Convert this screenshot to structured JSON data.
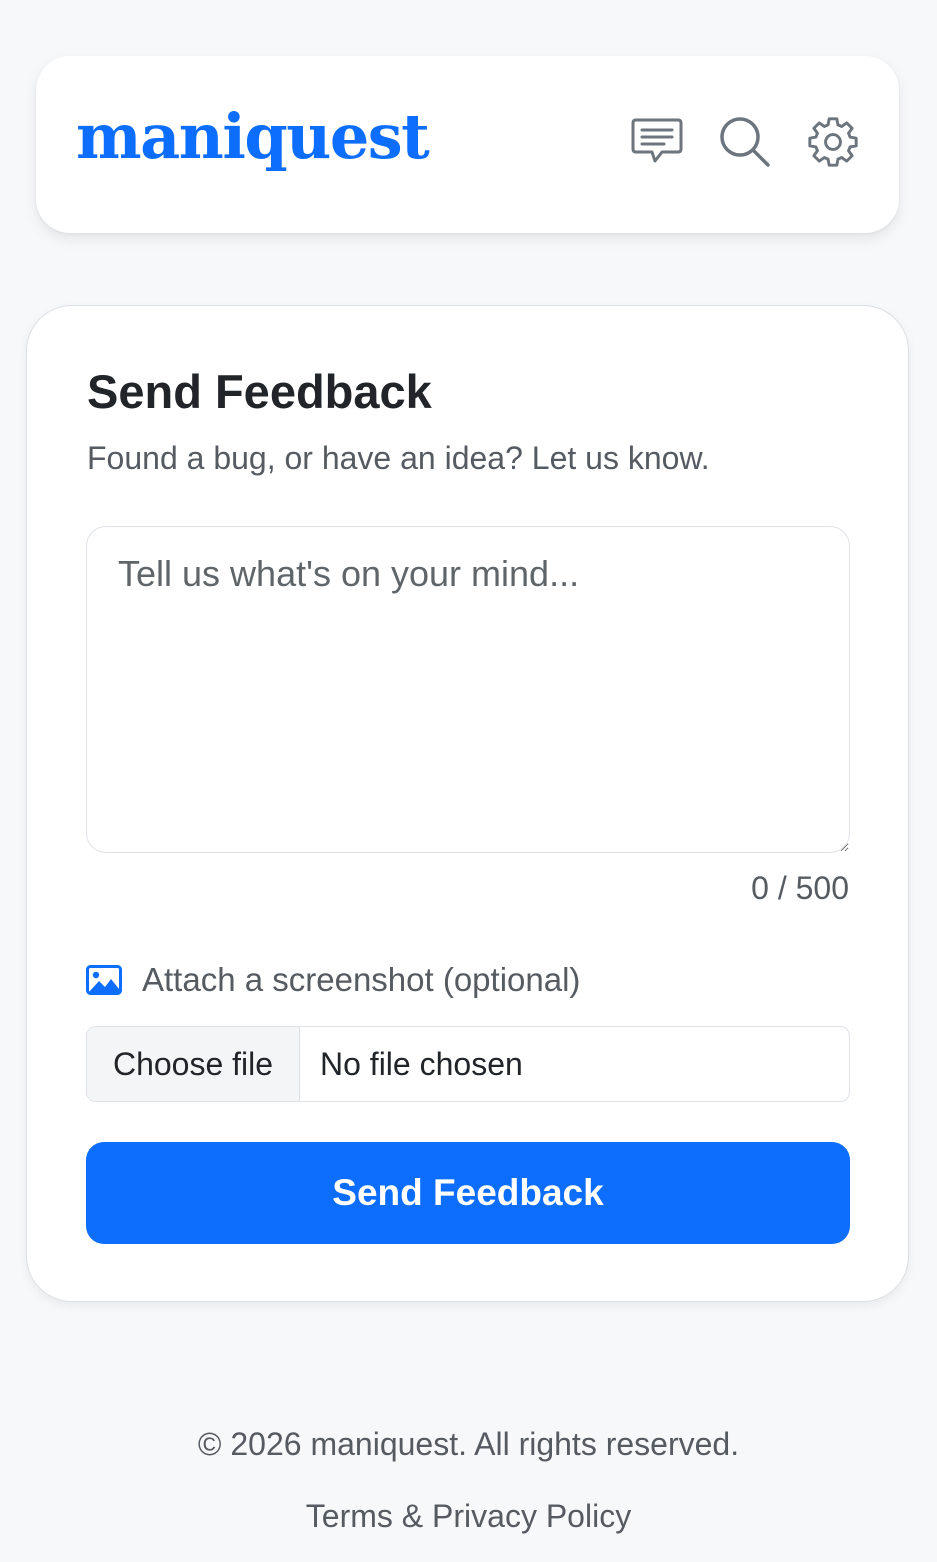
{
  "header": {
    "logo": "maniquest",
    "icons": [
      "feedback-icon",
      "search-icon",
      "settings-icon"
    ]
  },
  "feedback_form": {
    "title": "Send Feedback",
    "subtitle": "Found a bug, or have an idea? Let us know.",
    "message_placeholder": "Tell us what's on your mind...",
    "message_value": "",
    "char_count": "0 / 500",
    "attach_label": "Attach a screenshot (optional)",
    "file_button_label": "Choose file",
    "file_status": "No file chosen",
    "submit_label": "Send Feedback"
  },
  "footer": {
    "copyright": "© 2026 maniquest. All rights reserved.",
    "legal_link": "Terms & Privacy Policy"
  },
  "colors": {
    "accent": "#0d6efd",
    "background": "#f7f8fa",
    "text_muted": "#555b61",
    "icon": "#6c757d"
  }
}
